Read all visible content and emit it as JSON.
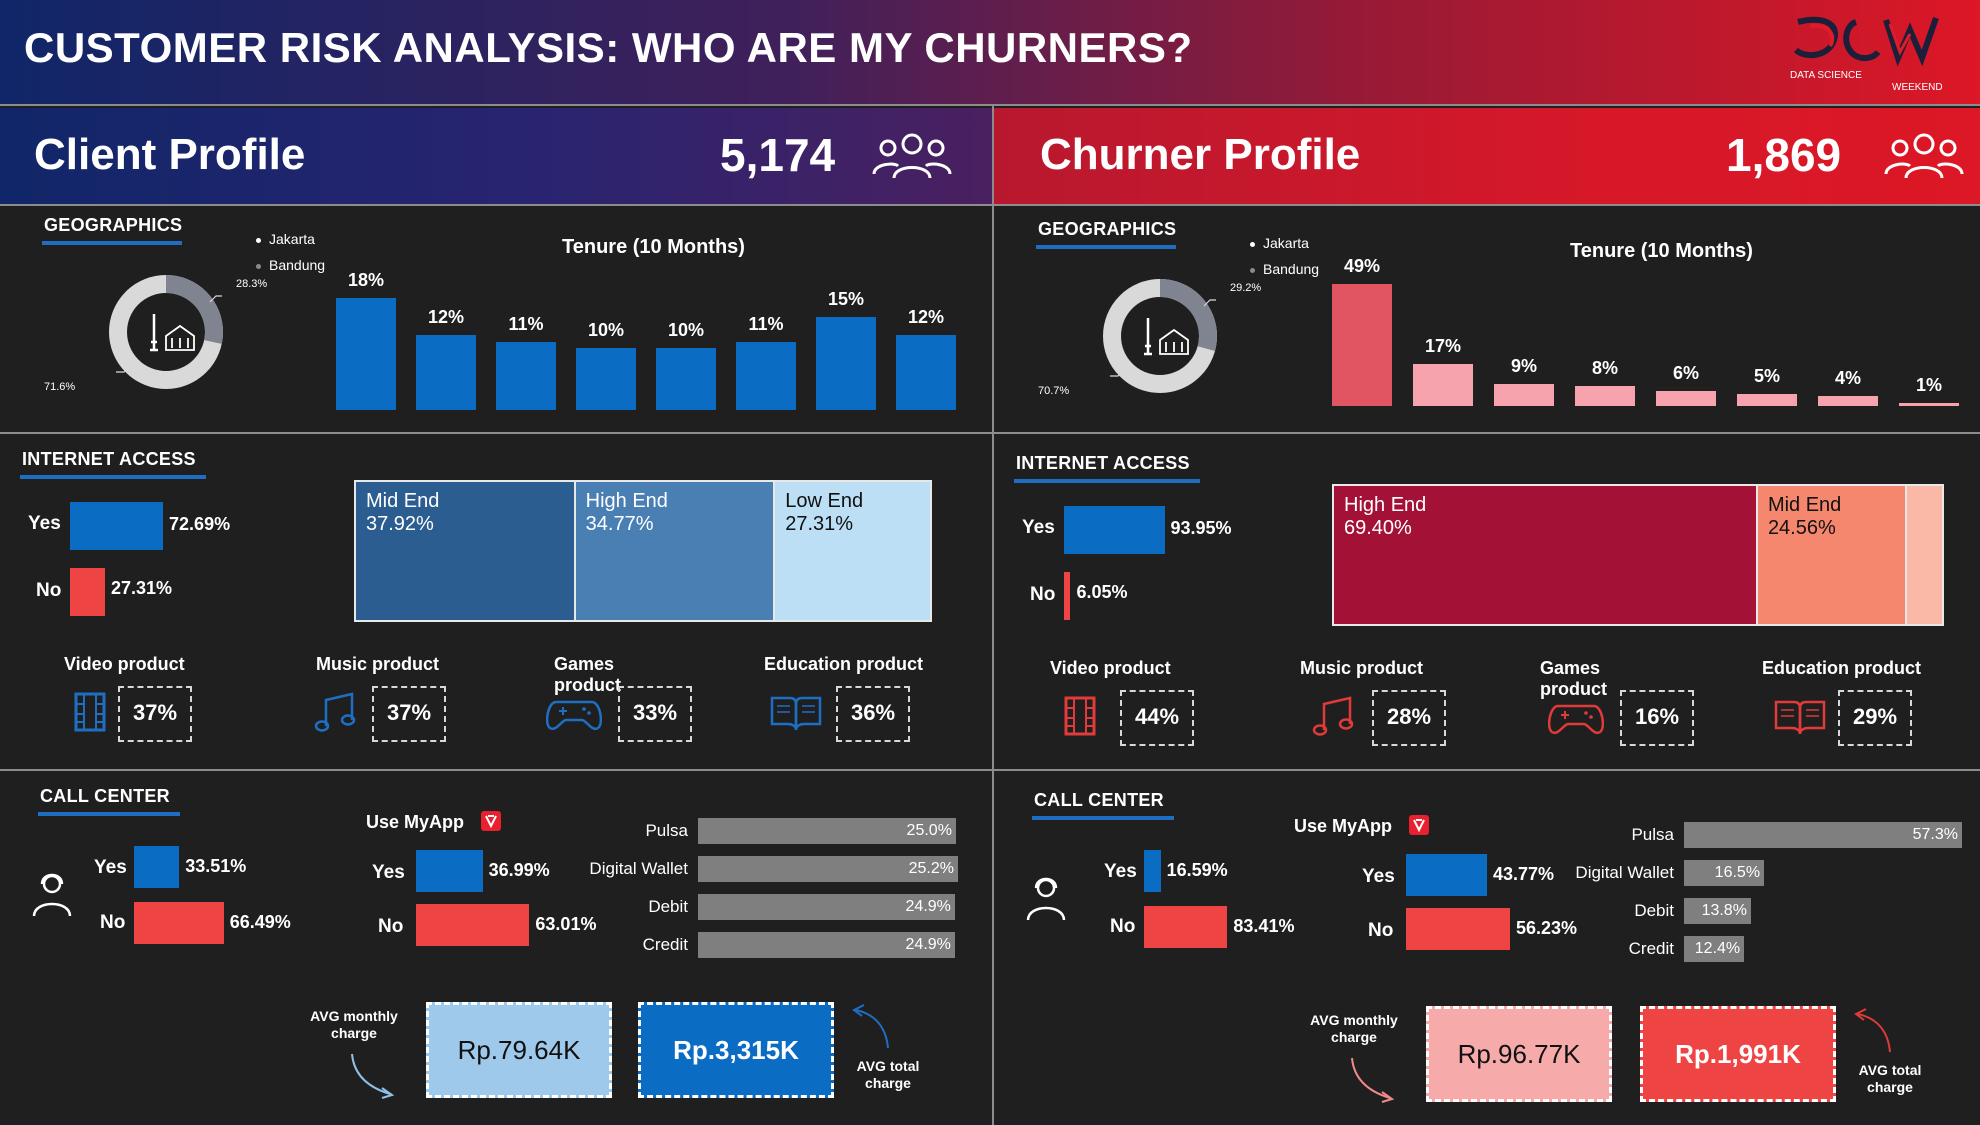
{
  "header": {
    "title": "CUSTOMER RISK ANALYSIS: WHO ARE MY CHURNERS?",
    "logo_text": "DATA SCIENCE",
    "logo_sub": "WEEKEND"
  },
  "colors": {
    "blue": "#0b6cc4",
    "red": "#ef4444",
    "churn_tenure_first": "#e05561",
    "churn_tenure": "#f6a3ad",
    "divider": "#8c8c8c"
  },
  "client": {
    "title": "Client Profile",
    "count": "5,174",
    "geographics": {
      "title": "GEOGRAPHICS",
      "legend": [
        "Jakarta",
        "Bandung"
      ],
      "jakarta_pct_label": "71.6%",
      "bandung_pct_label": "28.3%",
      "jakarta": 71.6,
      "bandung": 28.3
    },
    "tenure": {
      "title": "Tenure (10 Months)",
      "labels": [
        "18%",
        "12%",
        "11%",
        "10%",
        "10%",
        "11%",
        "15%",
        "12%"
      ],
      "values": [
        18,
        12,
        11,
        10,
        10,
        11,
        15,
        12
      ]
    },
    "internet": {
      "title": "INTERNET ACCESS",
      "yes_label": "Yes",
      "no_label": "No",
      "yes_pct": "72.69%",
      "no_pct": "27.31%",
      "yes": 72.69,
      "no": 27.31,
      "tiers": [
        {
          "name": "Mid End",
          "pct": "37.92%",
          "value": 37.92
        },
        {
          "name": "High End",
          "pct": "34.77%",
          "value": 34.77
        },
        {
          "name": "Low End",
          "pct": "27.31%",
          "value": 27.31
        }
      ]
    },
    "products": [
      {
        "title": "Video product",
        "pct": "37%",
        "icon": "film-icon"
      },
      {
        "title": "Music product",
        "pct": "37%",
        "icon": "music-note-icon"
      },
      {
        "title": "Games product",
        "pct": "33%",
        "icon": "gamepad-icon"
      },
      {
        "title": "Education product",
        "pct": "36%",
        "icon": "book-icon"
      }
    ],
    "call_center": {
      "title": "CALL CENTER",
      "yes_label": "Yes",
      "no_label": "No",
      "yes_pct": "33.51%",
      "no_pct": "66.49%",
      "yes": 33.51,
      "no": 66.49
    },
    "myapp": {
      "title": "Use MyApp",
      "yes_label": "Yes",
      "no_label": "No",
      "yes_pct": "36.99%",
      "no_pct": "63.01%",
      "yes": 36.99,
      "no": 63.01
    },
    "payment": [
      {
        "name": "Pulsa",
        "pct": "25.0%",
        "value": 25.0
      },
      {
        "name": "Digital Wallet",
        "pct": "25.2%",
        "value": 25.2
      },
      {
        "name": "Debit",
        "pct": "24.9%",
        "value": 24.9
      },
      {
        "name": "Credit",
        "pct": "24.9%",
        "value": 24.9
      }
    ],
    "avg_monthly_label": "AVG monthly charge",
    "avg_monthly": "Rp.79.64K",
    "avg_total_label": "AVG total charge",
    "avg_total": "Rp.3,315K"
  },
  "churner": {
    "title": "Churner Profile",
    "count": "1,869",
    "geographics": {
      "title": "GEOGRAPHICS",
      "legend": [
        "Jakarta",
        "Bandung"
      ],
      "jakarta_pct_label": "70.7%",
      "bandung_pct_label": "29.2%",
      "jakarta": 70.7,
      "bandung": 29.2
    },
    "tenure": {
      "title": "Tenure (10 Months)",
      "labels": [
        "49%",
        "17%",
        "9%",
        "8%",
        "6%",
        "5%",
        "4%",
        "1%"
      ],
      "values": [
        49,
        17,
        9,
        8,
        6,
        5,
        4,
        1
      ]
    },
    "internet": {
      "title": "INTERNET ACCESS",
      "yes_label": "Yes",
      "no_label": "No",
      "yes_pct": "93.95%",
      "no_pct": "6.05%",
      "yes": 93.95,
      "no": 6.05,
      "tiers": [
        {
          "name": "High End",
          "pct": "69.40%",
          "value": 69.4
        },
        {
          "name": "Mid End",
          "pct": "24.56%",
          "value": 24.56
        },
        {
          "name": "",
          "pct": "",
          "value": 6.04
        }
      ]
    },
    "products": [
      {
        "title": "Video product",
        "pct": "44%",
        "icon": "film-icon"
      },
      {
        "title": "Music product",
        "pct": "28%",
        "icon": "music-note-icon"
      },
      {
        "title": "Games product",
        "pct": "16%",
        "icon": "gamepad-icon"
      },
      {
        "title": "Education product",
        "pct": "29%",
        "icon": "book-icon"
      }
    ],
    "call_center": {
      "title": "CALL CENTER",
      "yes_label": "Yes",
      "no_label": "No",
      "yes_pct": "16.59%",
      "no_pct": "83.41%",
      "yes": 16.59,
      "no": 83.41
    },
    "myapp": {
      "title": "Use MyApp",
      "yes_label": "Yes",
      "no_label": "No",
      "yes_pct": "43.77%",
      "no_pct": "56.23%",
      "yes": 43.77,
      "no": 56.23
    },
    "payment": [
      {
        "name": "Pulsa",
        "pct": "57.3%",
        "value": 57.3
      },
      {
        "name": "Digital Wallet",
        "pct": "16.5%",
        "value": 16.5
      },
      {
        "name": "Debit",
        "pct": "13.8%",
        "value": 13.8
      },
      {
        "name": "Credit",
        "pct": "12.4%",
        "value": 12.4
      }
    ],
    "avg_monthly_label": "AVG monthly charge",
    "avg_monthly": "Rp.96.77K",
    "avg_total_label": "AVG total charge",
    "avg_total": "Rp.1,991K"
  }
}
